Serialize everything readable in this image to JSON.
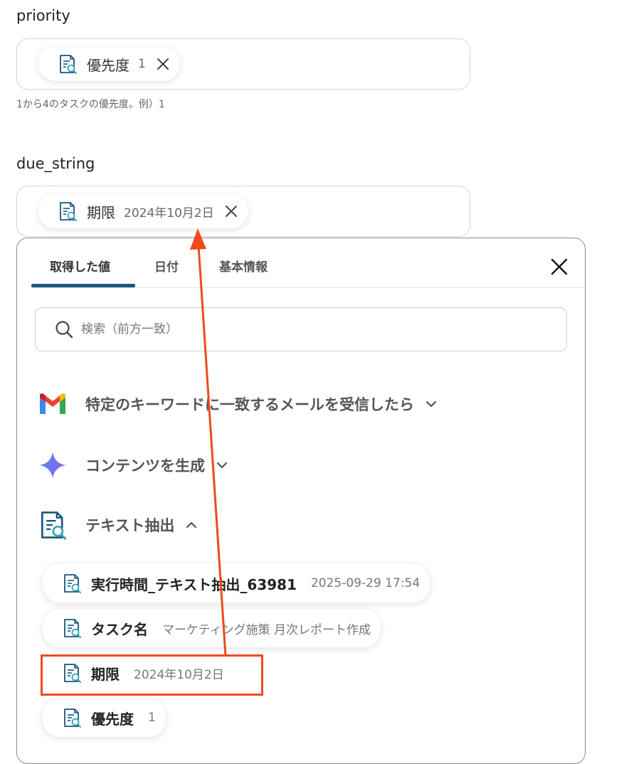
{
  "fields": {
    "priority": {
      "label": "priority",
      "chip_name": "優先度",
      "chip_value": "1",
      "help": "1から4のタスクの優先度。例）1"
    },
    "due_string": {
      "label": "due_string",
      "chip_name": "期限",
      "chip_value": "2024年10月2日"
    }
  },
  "panel": {
    "tabs": [
      "取得した値",
      "日付",
      "基本情報"
    ],
    "active_tab": 0,
    "search_placeholder": "検索（前方一致）",
    "groups": [
      {
        "name": "特定のキーワードに一致するメールを受信したら",
        "icon": "gmail-icon",
        "expanded": false
      },
      {
        "name": "コンテンツを生成",
        "icon": "sparkle-icon",
        "expanded": false
      },
      {
        "name": "テキスト抽出",
        "icon": "document-search-icon",
        "expanded": true
      }
    ],
    "items": [
      {
        "name": "実行時間_テキスト抽出_63981",
        "value": "2025-09-29 17:54"
      },
      {
        "name": "タスク名",
        "value": "マーケティング施策 月次レポート作成"
      },
      {
        "name": "期限",
        "value": "2024年10月2日"
      },
      {
        "name": "優先度",
        "value": "1"
      }
    ]
  },
  "colors": {
    "accent": "#165780",
    "annotation": "#f04a1c",
    "doc_icon": "#165780"
  }
}
